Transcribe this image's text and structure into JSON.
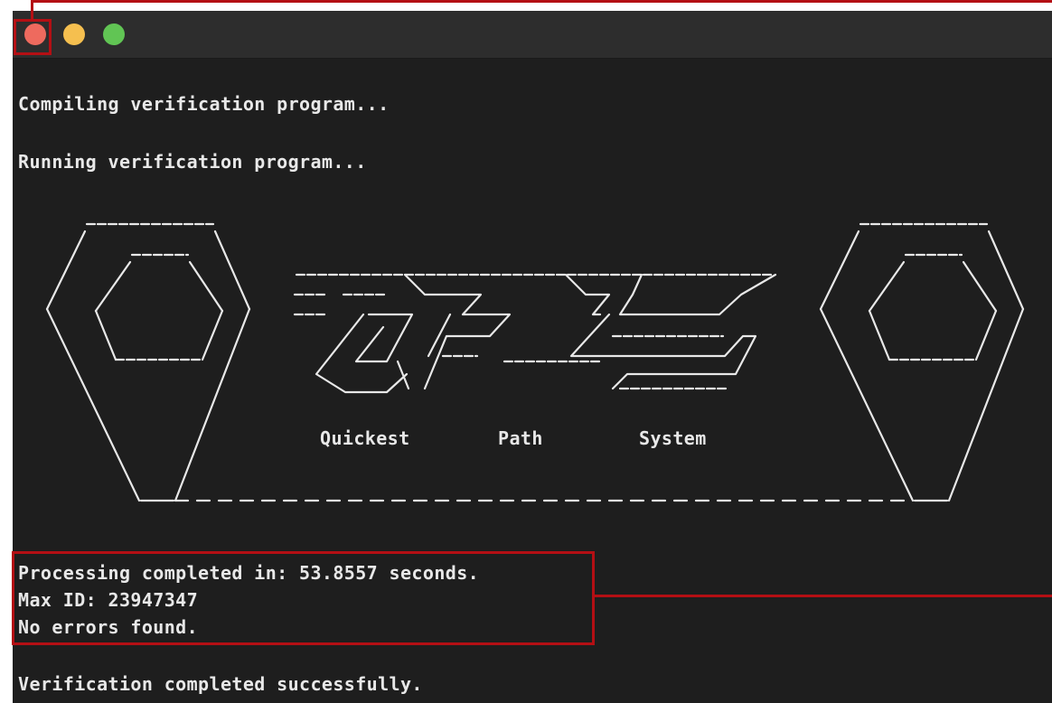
{
  "window": {
    "traffic_lights": [
      {
        "name": "close",
        "color": "#ee6a5e"
      },
      {
        "name": "minimize",
        "color": "#f5bf4f"
      },
      {
        "name": "zoom",
        "color": "#61c554"
      }
    ],
    "background": "#1e1e1e"
  },
  "terminal": {
    "lines": {
      "compile": "Compiling verification program...",
      "running": "Running verification program...",
      "processing": "Processing completed in: 53.8557 seconds.",
      "max_id": "Max ID: 23947347",
      "errors": "No errors found.",
      "verified": "Verification completed successfully."
    },
    "banner": {
      "tagline_words": [
        "Quickest",
        "Path",
        "System"
      ]
    }
  },
  "annotations": {
    "color": "#b40f14"
  }
}
